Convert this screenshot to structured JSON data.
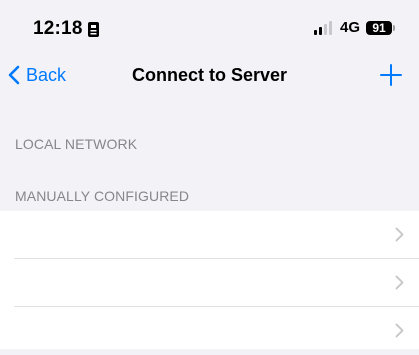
{
  "status_bar": {
    "time": "12:18",
    "network": "4G",
    "battery": "91",
    "icons": [
      "id-card-icon",
      "signal-icon",
      "battery-icon"
    ]
  },
  "nav": {
    "back_label": "Back",
    "title": "Connect to Server",
    "add_icon": "plus-icon",
    "accent_color": "#007aff"
  },
  "sections": {
    "local_network": "LOCAL NETWORK",
    "manually_configured": "MANUALLY CONFIGURED"
  },
  "server_rows": [
    {
      "label": ""
    },
    {
      "label": ""
    },
    {
      "label": ""
    }
  ]
}
